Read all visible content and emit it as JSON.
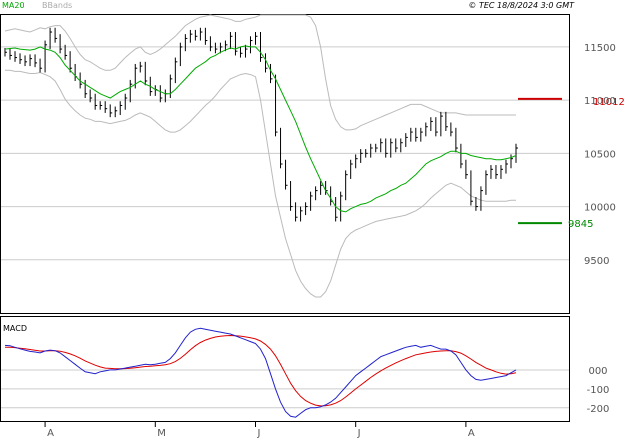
{
  "header": {
    "legend_ma": "MA20",
    "legend_bands": "BBands",
    "copyright": "© TEC 18/8/2024 3:0 GMT"
  },
  "price_axis": {
    "ticks": [
      {
        "value": 11500,
        "label": "11500"
      },
      {
        "value": 11000,
        "label": "11000"
      },
      {
        "value": 10500,
        "label": "10500"
      },
      {
        "value": 10000,
        "label": "10000"
      },
      {
        "value": 9500,
        "label": "9500"
      }
    ],
    "range": [
      9000,
      11800
    ]
  },
  "levels": {
    "resistance": {
      "value": 11012,
      "label": "11012",
      "color": "#cc0000"
    },
    "support": {
      "value": 9845,
      "label": "9845",
      "color": "#008800"
    }
  },
  "macd_panel": {
    "title": "MACD",
    "range": [
      -270,
      280
    ],
    "ticks": [
      {
        "value": 0,
        "label": "000"
      },
      {
        "value": -100,
        "label": "-100"
      },
      {
        "value": -200,
        "label": "-200"
      }
    ]
  },
  "x_axis": {
    "months": [
      {
        "index": 8,
        "label": "A"
      },
      {
        "index": 30,
        "label": "M"
      },
      {
        "index": 50,
        "label": "J"
      },
      {
        "index": 70,
        "label": "J"
      },
      {
        "index": 92,
        "label": "A"
      }
    ]
  },
  "colors": {
    "ma": "#00aa00",
    "bands": "#bbbbbb",
    "bars": "#000000",
    "macd": "#2222cc",
    "signal": "#dd0000",
    "grid": "#cccccc"
  },
  "chart_data": {
    "type": "line",
    "title": "",
    "bars_count": 103,
    "close": [
      11450,
      11420,
      11400,
      11380,
      11360,
      11390,
      11350,
      11300,
      11520,
      11640,
      11580,
      11480,
      11420,
      11300,
      11220,
      11150,
      11060,
      11020,
      10950,
      10950,
      10920,
      10880,
      10900,
      10950,
      11020,
      11150,
      11300,
      11320,
      11180,
      11080,
      11100,
      11020,
      11060,
      11200,
      11360,
      11500,
      11580,
      11620,
      11600,
      11640,
      11560,
      11500,
      11480,
      11500,
      11520,
      11600,
      11460,
      11440,
      11480,
      11560,
      11600,
      11400,
      11300,
      11200,
      10700,
      10400,
      10200,
      10000,
      9900,
      9960,
      10000,
      10100,
      10150,
      10200,
      10150,
      10050,
      9900,
      10100,
      10300,
      10400,
      10450,
      10500,
      10500,
      10550,
      10550,
      10600,
      10500,
      10600,
      10550,
      10600,
      10650,
      10700,
      10650,
      10700,
      10750,
      10800,
      10700,
      10850,
      10750,
      10700,
      10550,
      10400,
      10300,
      10050,
      10000,
      10150,
      10300,
      10350,
      10300,
      10350,
      10400,
      10450,
      10550
    ],
    "ma20": [
      11480,
      11485,
      11490,
      11480,
      11475,
      11470,
      11480,
      11500,
      11480,
      11470,
      11450,
      11400,
      11330,
      11280,
      11230,
      11180,
      11150,
      11120,
      11090,
      11060,
      11040,
      11020,
      11050,
      11080,
      11100,
      11120,
      11150,
      11180,
      11150,
      11130,
      11100,
      11080,
      11060,
      11060,
      11100,
      11150,
      11200,
      11250,
      11300,
      11330,
      11360,
      11400,
      11420,
      11450,
      11470,
      11490,
      11480,
      11500,
      11510,
      11500,
      11500,
      11450,
      11380,
      11280,
      11200,
      11100,
      11000,
      10900,
      10800,
      10680,
      10560,
      10450,
      10350,
      10250,
      10150,
      10080,
      10000,
      9960,
      9950,
      9980,
      10000,
      10020,
      10030,
      10050,
      10080,
      10100,
      10120,
      10150,
      10170,
      10200,
      10220,
      10260,
      10300,
      10350,
      10400,
      10430,
      10450,
      10470,
      10500,
      10520,
      10520,
      10500,
      10500,
      10480,
      10470,
      10460,
      10450,
      10450,
      10440,
      10440,
      10450,
      10460,
      10480
    ],
    "bb_upper": [
      11650,
      11660,
      11670,
      11660,
      11650,
      11640,
      11660,
      11680,
      11670,
      11690,
      11700,
      11700,
      11650,
      11580,
      11500,
      11430,
      11380,
      11360,
      11330,
      11300,
      11280,
      11280,
      11300,
      11350,
      11400,
      11440,
      11480,
      11500,
      11450,
      11430,
      11450,
      11480,
      11520,
      11560,
      11600,
      11650,
      11700,
      11730,
      11760,
      11780,
      11790,
      11800,
      11790,
      11780,
      11770,
      11760,
      11740,
      11740,
      11760,
      11770,
      11780,
      11800,
      11800,
      11800,
      11800,
      11800,
      11800,
      11800,
      11800,
      11800,
      11800,
      11780,
      11700,
      11500,
      11200,
      10950,
      10820,
      10750,
      10720,
      10720,
      10730,
      10760,
      10780,
      10800,
      10820,
      10840,
      10860,
      10880,
      10900,
      10920,
      10940,
      10960,
      10960,
      10960,
      10940,
      10920,
      10900,
      10880,
      10880,
      10880,
      10880,
      10870,
      10860,
      10860,
      10860,
      10860,
      10860,
      10860,
      10860,
      10860,
      10860,
      10860,
      10860
    ],
    "bb_lower": [
      11280,
      11280,
      11270,
      11270,
      11260,
      11250,
      11250,
      11260,
      11240,
      11220,
      11180,
      11100,
      11010,
      10950,
      10900,
      10860,
      10830,
      10820,
      10800,
      10800,
      10790,
      10780,
      10790,
      10800,
      10810,
      10830,
      10860,
      10880,
      10860,
      10840,
      10800,
      10760,
      10720,
      10700,
      10700,
      10720,
      10760,
      10800,
      10850,
      10900,
      10950,
      10990,
      11040,
      11100,
      11150,
      11200,
      11220,
      11240,
      11250,
      11240,
      11220,
      11000,
      10700,
      10400,
      10100,
      9900,
      9700,
      9550,
      9400,
      9300,
      9230,
      9180,
      9150,
      9150,
      9200,
      9300,
      9450,
      9600,
      9700,
      9750,
      9780,
      9800,
      9820,
      9840,
      9860,
      9870,
      9880,
      9890,
      9900,
      9910,
      9920,
      9940,
      9960,
      9990,
      10030,
      10080,
      10120,
      10160,
      10200,
      10220,
      10200,
      10180,
      10140,
      10100,
      10080,
      10060,
      10050,
      10050,
      10050,
      10050,
      10050,
      10060,
      10060
    ],
    "macd": [
      130,
      128,
      120,
      112,
      105,
      98,
      95,
      90,
      100,
      105,
      102,
      90,
      70,
      50,
      30,
      10,
      -10,
      -15,
      -20,
      -10,
      -5,
      0,
      0,
      5,
      10,
      15,
      20,
      25,
      30,
      28,
      30,
      35,
      40,
      60,
      90,
      130,
      170,
      200,
      215,
      220,
      215,
      210,
      205,
      200,
      195,
      190,
      180,
      170,
      160,
      150,
      140,
      110,
      60,
      -20,
      -100,
      -170,
      -220,
      -245,
      -250,
      -230,
      -210,
      -200,
      -200,
      -195,
      -185,
      -170,
      -150,
      -120,
      -90,
      -60,
      -30,
      -10,
      10,
      30,
      50,
      70,
      80,
      90,
      100,
      110,
      120,
      125,
      130,
      120,
      125,
      130,
      120,
      110,
      110,
      100,
      80,
      40,
      0,
      -30,
      -50,
      -55,
      -50,
      -45,
      -40,
      -35,
      -30,
      -15,
      0
    ],
    "signal": [
      120,
      120,
      118,
      115,
      112,
      108,
      104,
      100,
      100,
      101,
      101,
      99,
      93,
      85,
      75,
      62,
      48,
      36,
      25,
      16,
      10,
      8,
      6,
      6,
      7,
      9,
      12,
      15,
      18,
      20,
      22,
      24,
      27,
      33,
      44,
      61,
      83,
      107,
      128,
      145,
      158,
      167,
      174,
      178,
      181,
      182,
      181,
      179,
      175,
      170,
      164,
      153,
      135,
      110,
      75,
      30,
      -20,
      -70,
      -110,
      -140,
      -162,
      -176,
      -186,
      -190,
      -189,
      -185,
      -176,
      -162,
      -143,
      -122,
      -100,
      -80,
      -60,
      -40,
      -22,
      -5,
      10,
      24,
      37,
      49,
      60,
      70,
      80,
      85,
      90,
      95,
      98,
      100,
      102,
      101,
      97,
      89,
      75,
      58,
      40,
      25,
      10,
      0,
      -10,
      -18,
      -22,
      -20,
      -15
    ]
  }
}
